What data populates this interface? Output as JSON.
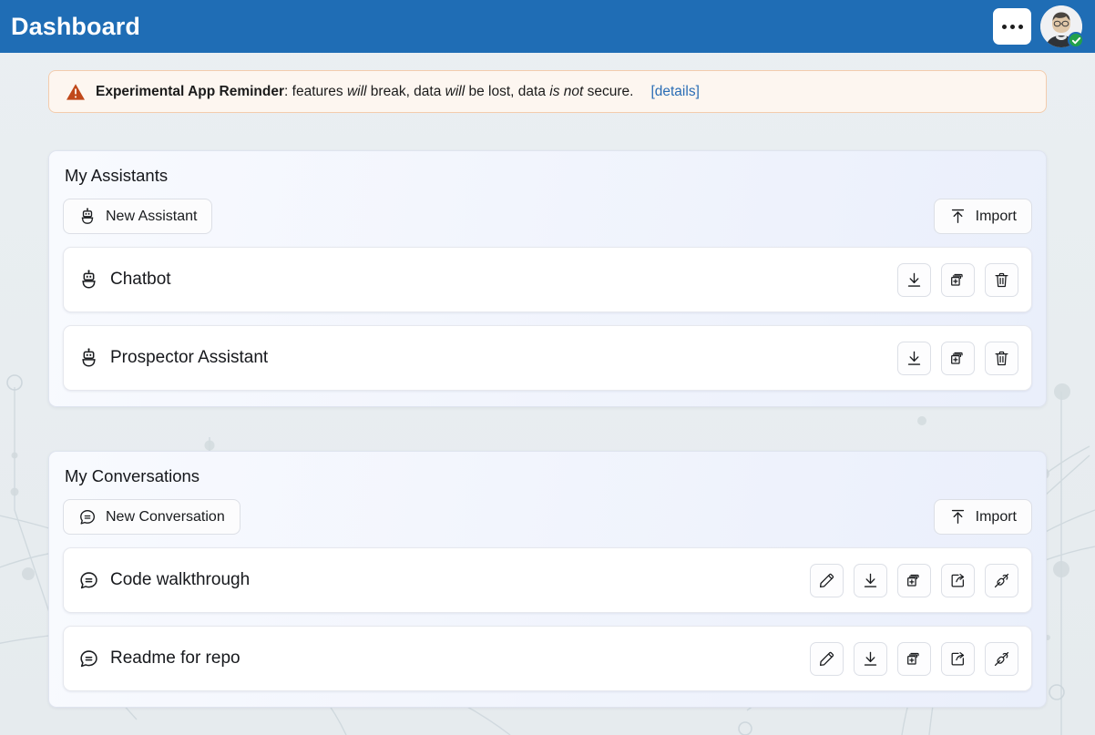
{
  "appbar": {
    "title": "Dashboard",
    "menu_button_label": "•••",
    "avatar_name": "user-avatar",
    "avatar_status": "verified"
  },
  "banner": {
    "icon": "warning-triangle-icon",
    "title": "Experimental App Reminder",
    "separator": ": ",
    "seg1": "features ",
    "em1": "will",
    "seg2": " break, data ",
    "em2": "will",
    "seg3": " be lost, data ",
    "em3": "is not",
    "seg4": " secure.",
    "details_link": "[details]",
    "accent_color": "#c0481a",
    "background_color": "#fdf6f0",
    "border_color": "#f3ccad",
    "link_color": "#2a6db5"
  },
  "cards": [
    {
      "id": "assistants",
      "title": "My Assistants",
      "new_button": {
        "label": "New Assistant",
        "icon": "robot-icon"
      },
      "import_button": {
        "label": "Import",
        "icon": "upload-arrow-icon"
      },
      "items": [
        {
          "label": "Chatbot",
          "icon": "robot-icon",
          "actions": [
            {
              "name": "download",
              "icon": "download-icon"
            },
            {
              "name": "duplicate",
              "icon": "duplicate-plus-icon"
            },
            {
              "name": "delete",
              "icon": "trash-icon"
            }
          ]
        },
        {
          "label": "Prospector Assistant",
          "icon": "robot-icon",
          "actions": [
            {
              "name": "download",
              "icon": "download-icon"
            },
            {
              "name": "duplicate",
              "icon": "duplicate-plus-icon"
            },
            {
              "name": "delete",
              "icon": "trash-icon"
            }
          ]
        }
      ]
    },
    {
      "id": "conversations",
      "title": "My Conversations",
      "new_button": {
        "label": "New Conversation",
        "icon": "chat-bubble-icon"
      },
      "import_button": {
        "label": "Import",
        "icon": "upload-arrow-icon"
      },
      "items": [
        {
          "label": "Code walkthrough",
          "icon": "chat-bubble-icon",
          "actions": [
            {
              "name": "edit",
              "icon": "pencil-icon"
            },
            {
              "name": "download",
              "icon": "download-icon"
            },
            {
              "name": "duplicate",
              "icon": "duplicate-plus-icon"
            },
            {
              "name": "share",
              "icon": "share-icon"
            },
            {
              "name": "connect",
              "icon": "plug-connect-icon"
            }
          ]
        },
        {
          "label": "Readme for repo",
          "icon": "chat-bubble-icon",
          "actions": [
            {
              "name": "edit",
              "icon": "pencil-icon"
            },
            {
              "name": "download",
              "icon": "download-icon"
            },
            {
              "name": "duplicate",
              "icon": "duplicate-plus-icon"
            },
            {
              "name": "share",
              "icon": "share-icon"
            },
            {
              "name": "connect",
              "icon": "plug-connect-icon"
            }
          ]
        }
      ]
    }
  ],
  "theme": {
    "appbar_color": "#1f6db5",
    "page_background": "#e8edf0",
    "card_gradient_start": "#f8fafe",
    "card_gradient_end": "#eaeffb",
    "row_background": "#ffffff"
  }
}
